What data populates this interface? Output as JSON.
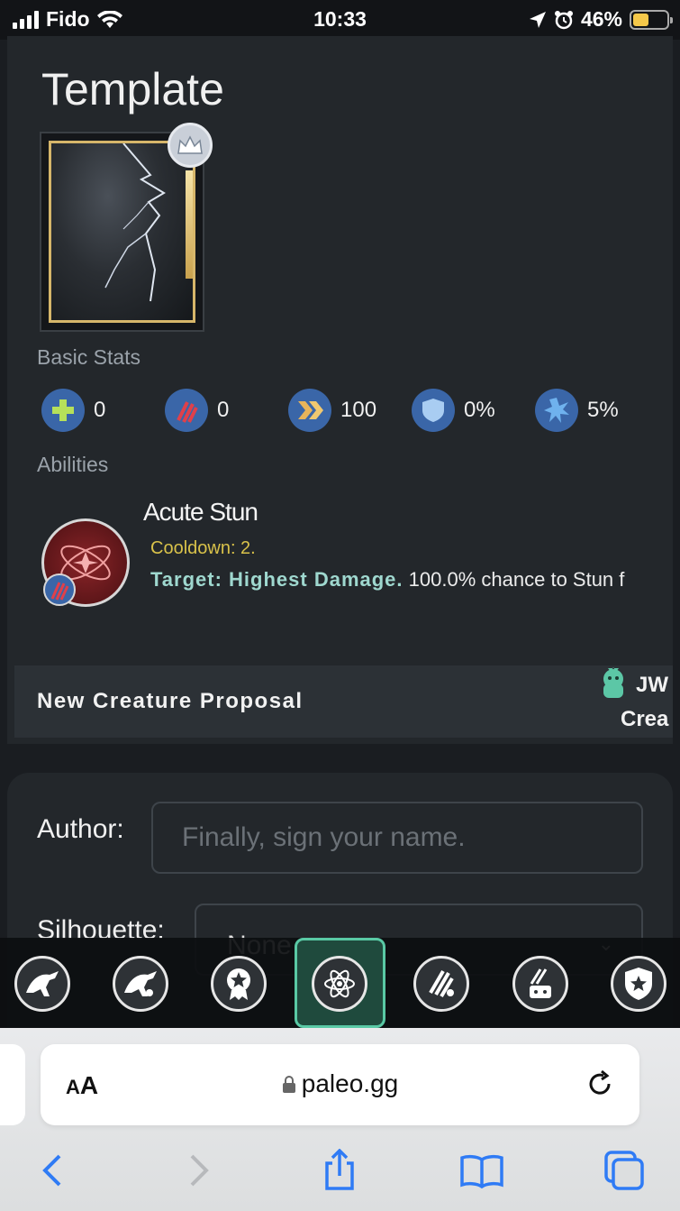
{
  "status_bar": {
    "carrier": "Fido",
    "time": "10:33",
    "battery": "46%"
  },
  "card": {
    "title": "Template",
    "basic_stats_label": "Basic Stats",
    "stats": [
      {
        "icon": "health-icon",
        "value": "0"
      },
      {
        "icon": "damage-icon",
        "value": "0"
      },
      {
        "icon": "speed-icon",
        "value": "100"
      },
      {
        "icon": "armor-icon",
        "value": "0%"
      },
      {
        "icon": "critical-icon",
        "value": "5%"
      }
    ],
    "abilities_label": "Abilities",
    "ability": {
      "name": "Acute Stun",
      "cooldown": "Cooldown: 2.",
      "target": "Target: Highest Damage.",
      "description": "100.0% chance to Stun f"
    },
    "proposal_bar": {
      "title": "New Creature Proposal",
      "brand_line1": "JW",
      "brand_line2": "Crea"
    }
  },
  "form": {
    "author_label": "Author:",
    "author_placeholder": "Finally, sign your name.",
    "silhouette_label": "Silhouette:",
    "silhouette_value": "None"
  },
  "app_nav": [
    {
      "icon": "jurassic-world-trex-icon"
    },
    {
      "icon": "jurassic-world-trex-map-icon"
    },
    {
      "icon": "award-star-icon"
    },
    {
      "icon": "atom-icon",
      "active": true
    },
    {
      "icon": "claw-location-icon"
    },
    {
      "icon": "claw-robot-icon"
    },
    {
      "icon": "shield-star-icon"
    }
  ],
  "safari": {
    "text_size_label": "AA",
    "url": "paleo.gg"
  },
  "colors": {
    "accent": "#59c9a5",
    "stat_blue": "#3a66a8",
    "cooldown": "#d9c24a",
    "target": "#9fd8cf",
    "gold_frame": "#d6b66a"
  }
}
